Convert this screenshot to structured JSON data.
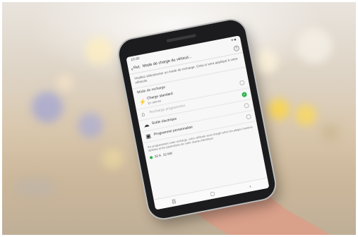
{
  "status": {
    "time": "10:30",
    "icons": "▾ ■"
  },
  "appbar": {
    "back_icon": "‹",
    "back_label": "Ret.",
    "title": "Mode de charge du véhicul...",
    "help_icon": "?"
  },
  "intro": "Veuillez sélectionner un mode de recharge. Celui-ci sera appliqué à votre véhicule.",
  "section_label": "Mode de recharge",
  "options": [
    {
      "icon": "⚡",
      "label": "Charge standard",
      "sub": "En attente",
      "selected": false,
      "dimmed": false
    },
    {
      "icon": "⌂",
      "label": "Recharge programmée",
      "sub": "",
      "selected": true,
      "dimmed": true
    },
    {
      "icon": "☁",
      "label": "Solde électrique",
      "sub": "",
      "selected": false,
      "dimmed": false
    },
    {
      "icon": "▣",
      "label": "Programme personnalisé",
      "sub": "",
      "selected": false,
      "dimmed": false
    }
  ],
  "footnote": "En programmant votre recharge, votre véhicule sera chargé selon les plages horaires définies et les paramètres de votre réseau électrique.",
  "value_row": {
    "label": "32 A",
    "value": "22 kW"
  },
  "navbar": {
    "recent": "|||",
    "home": "▢",
    "back": "‹"
  }
}
